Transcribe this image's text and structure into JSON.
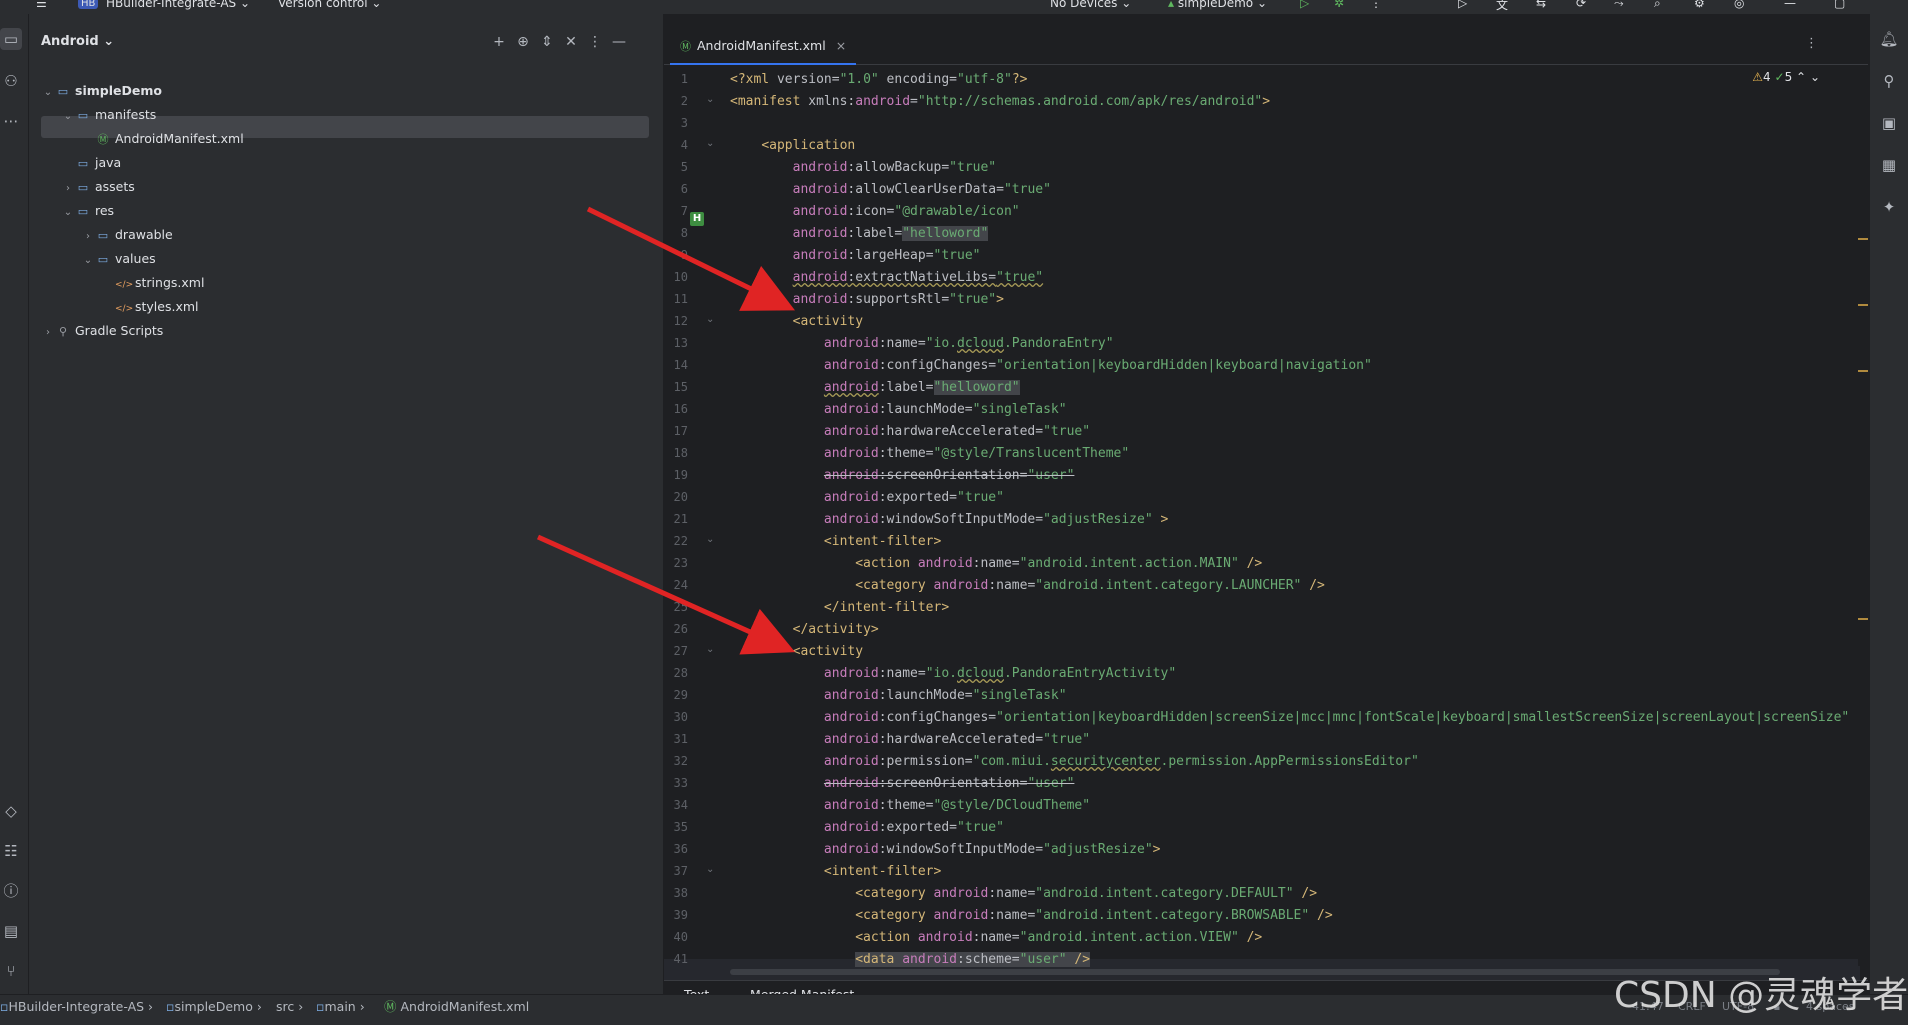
{
  "titlebar": {
    "project_badge": "HB",
    "project_name": "HBuilder-Integrate-AS",
    "vcs": "Version control",
    "devices": "No Devices",
    "run_config": "simpleDemo"
  },
  "project_panel": {
    "view_mode": "Android",
    "tree": [
      {
        "label": "simpleDemo",
        "depth": 0,
        "expanded": true,
        "icon": "module-folder-icon",
        "bold": true
      },
      {
        "label": "manifests",
        "depth": 1,
        "expanded": true,
        "icon": "folder-icon"
      },
      {
        "label": "AndroidManifest.xml",
        "depth": 2,
        "icon": "manifest-file-icon",
        "selected": true
      },
      {
        "label": "java",
        "depth": 1,
        "icon": "folder-icon"
      },
      {
        "label": "assets",
        "depth": 1,
        "expanded": false,
        "icon": "folder-icon"
      },
      {
        "label": "res",
        "depth": 1,
        "expanded": true,
        "icon": "folder-icon"
      },
      {
        "label": "drawable",
        "depth": 2,
        "expanded": false,
        "icon": "folder-icon"
      },
      {
        "label": "values",
        "depth": 2,
        "expanded": true,
        "icon": "folder-icon"
      },
      {
        "label": "strings.xml",
        "depth": 3,
        "icon": "xml-file-icon"
      },
      {
        "label": "styles.xml",
        "depth": 3,
        "icon": "xml-file-icon"
      },
      {
        "label": "Gradle Scripts",
        "depth": 0,
        "expanded": false,
        "icon": "gradle-icon"
      }
    ]
  },
  "editor": {
    "tab_label": "AndroidManifest.xml",
    "inspections": {
      "warnings": "4",
      "weak_warnings": "5"
    },
    "line_numbers": [
      "1",
      "2",
      "3",
      "4",
      "5",
      "6",
      "7",
      "8",
      "9",
      "10",
      "11",
      "12",
      "13",
      "14",
      "15",
      "16",
      "17",
      "18",
      "19",
      "20",
      "21",
      "22",
      "23",
      "24",
      "25",
      "26",
      "27",
      "28",
      "29",
      "30",
      "31",
      "32",
      "33",
      "34",
      "35",
      "36",
      "37",
      "38",
      "39",
      "40",
      "41"
    ],
    "bottom_tabs": [
      "Text",
      "Merged Manifest"
    ]
  },
  "statusbar": {
    "breadcrumbs": [
      "HBuilder-Integrate-AS",
      "simpleDemo",
      "src",
      "main",
      "AndroidManifest.xml"
    ],
    "position": "41:47",
    "line_sep": "CRLF",
    "encoding": "UTF-8",
    "indent": "4 spaces"
  },
  "watermark": "CSDN @灵魂学者",
  "colors": {
    "accent": "#3574f0",
    "tag": "#d5b778",
    "namespace": "#c77dbb",
    "string": "#6aab73",
    "annotation_arrow": "#e02424"
  }
}
